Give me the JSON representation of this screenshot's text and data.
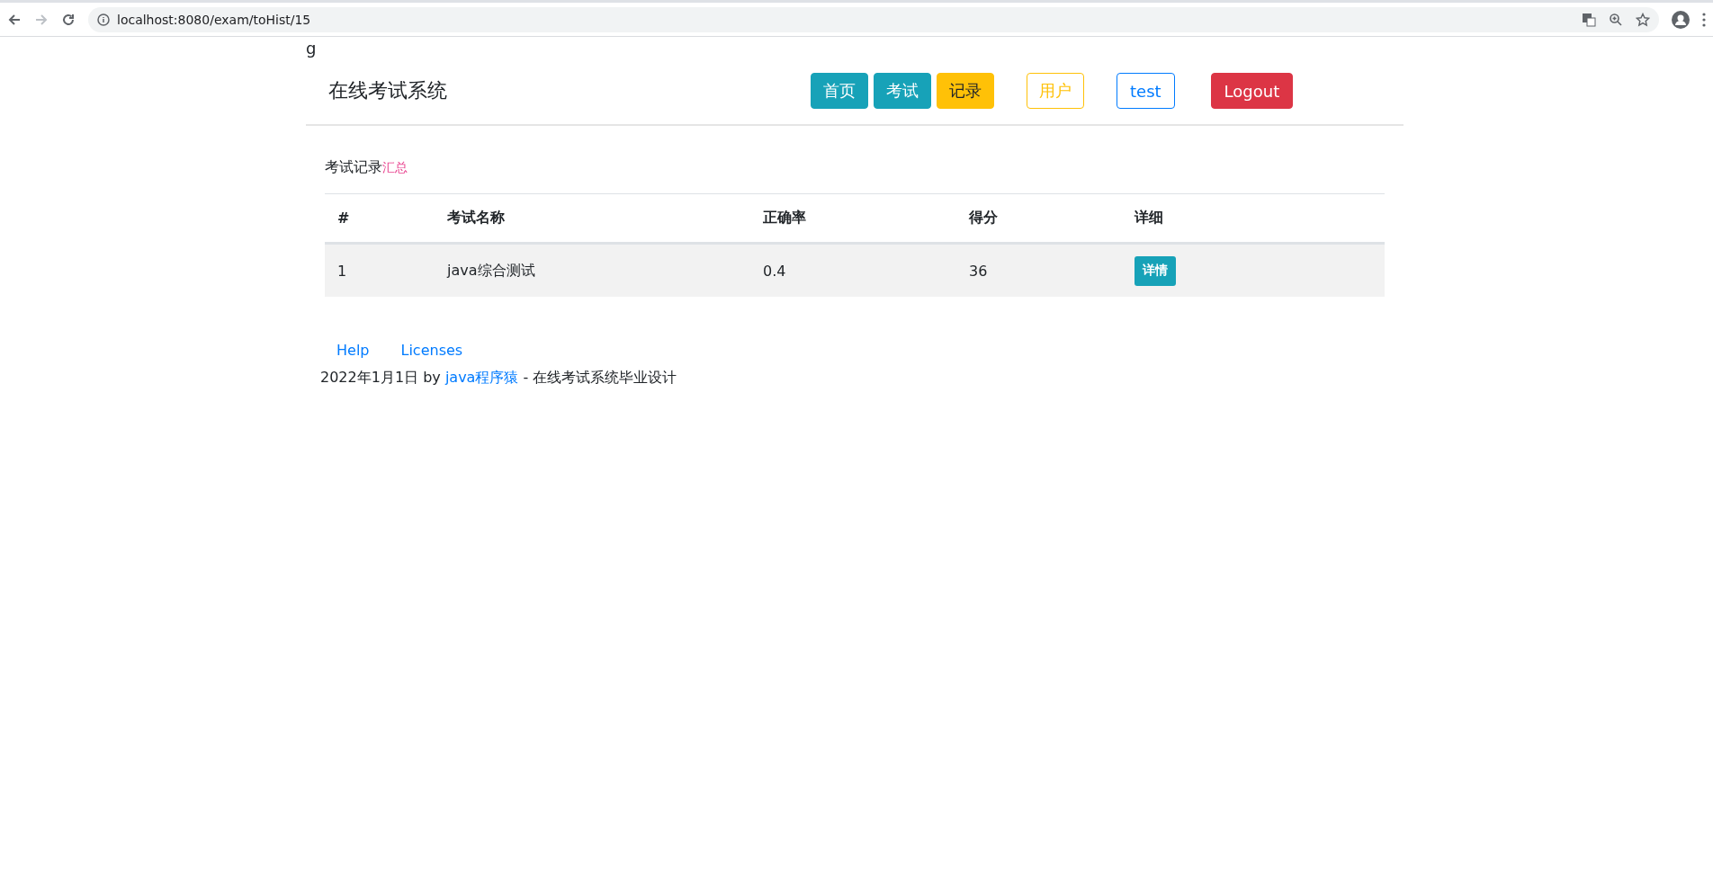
{
  "browser": {
    "url": "localhost:8080/exam/toHist/15"
  },
  "stray_text": "g",
  "header": {
    "brand": "在线考试系统",
    "buttons": [
      {
        "label": "首页",
        "kind": "info"
      },
      {
        "label": "考试",
        "kind": "info"
      },
      {
        "label": "记录",
        "kind": "warning"
      },
      {
        "label": "用户",
        "kind": "outline-warning"
      },
      {
        "label": "test",
        "kind": "outline-primary"
      },
      {
        "label": "Logout",
        "kind": "danger"
      }
    ]
  },
  "records": {
    "title": "考试记录",
    "title_accent": "汇总",
    "columns": [
      "#",
      "考试名称",
      "正确率",
      "得分",
      "详细"
    ],
    "rows": [
      {
        "cells": [
          "1",
          "java综合测试",
          "0.4",
          "36"
        ],
        "action": "详情"
      }
    ]
  },
  "footer": {
    "links": [
      "Help",
      "Licenses"
    ],
    "date_by": "2022年1月1日 by",
    "author": "java程序猿",
    "suffix": "- 在线考试系统毕业设计"
  }
}
